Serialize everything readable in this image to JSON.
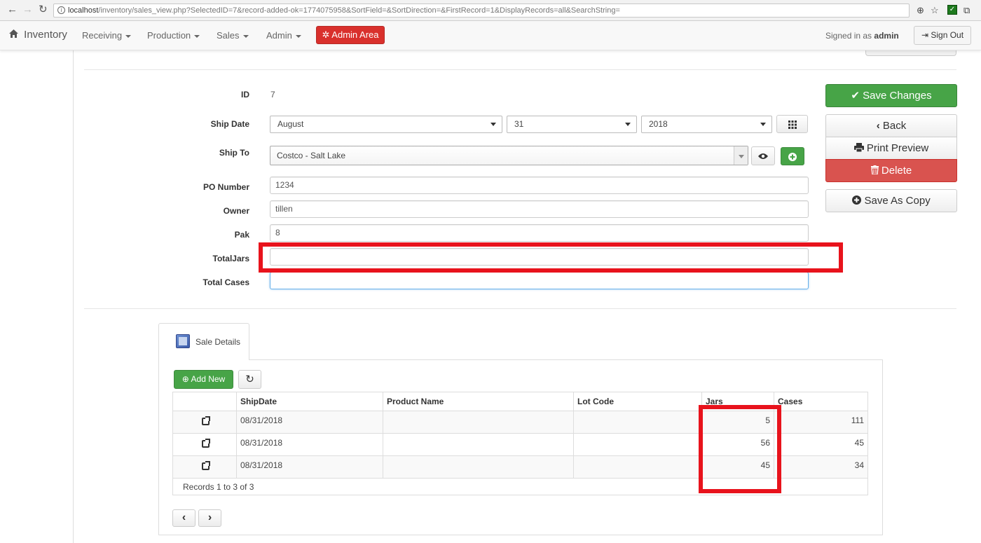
{
  "browser": {
    "url_host": "localhost",
    "url_path": "/inventory/sales_view.php?SelectedID=7&record-added-ok=1774075958&SortField=&SortDirection=&FirstRecord=1&DisplayRecords=all&SearchString=",
    "back": "←",
    "forward": "→",
    "reload": "↻",
    "zoom": "⊕",
    "star": "☆",
    "cast": "⧉"
  },
  "navbar": {
    "brand": "Inventory",
    "menus": [
      "Receiving",
      "Production",
      "Sales",
      "Admin"
    ],
    "admin_area": "Admin Area",
    "signed_in_prefix": "Signed in as",
    "username": "admin",
    "sign_out": "Sign Out"
  },
  "form": {
    "id_label": "ID",
    "id_value": "7",
    "ship_date_label": "Ship Date",
    "ship_month": "August",
    "ship_day": "31",
    "ship_year": "2018",
    "ship_to_label": "Ship To",
    "ship_to_value": "Costco - Salt Lake",
    "po_label": "PO Number",
    "po_value": "1234",
    "owner_label": "Owner",
    "owner_value": "tillen",
    "pak_label": "Pak",
    "pak_value": "8",
    "total_jars_label": "TotalJars",
    "total_jars_value": "",
    "total_cases_label": "Total Cases",
    "total_cases_value": ""
  },
  "actions": {
    "save": "Save Changes",
    "back": "Back",
    "print": "Print Preview",
    "delete": "Delete",
    "save_copy": "Save As Copy"
  },
  "details": {
    "tab_label": "Sale Details",
    "add_new": "Add New",
    "columns": [
      "ShipDate",
      "Product Name",
      "Lot Code",
      "Jars",
      "Cases"
    ],
    "rows": [
      {
        "ship_date": "08/31/2018",
        "product": "",
        "lot": "",
        "jars": "5",
        "cases": "111"
      },
      {
        "ship_date": "08/31/2018",
        "product": "",
        "lot": "",
        "jars": "56",
        "cases": "45"
      },
      {
        "ship_date": "08/31/2018",
        "product": "",
        "lot": "",
        "jars": "45",
        "cases": "34"
      }
    ],
    "records_text": "Records 1 to 3 of 3"
  },
  "colors": {
    "green": "#47a447",
    "red": "#d9534f",
    "highlight": "#e8131c"
  }
}
